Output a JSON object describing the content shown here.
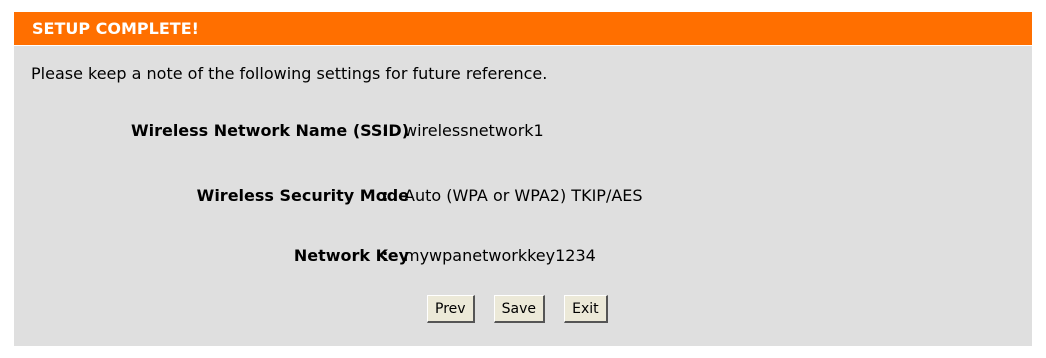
{
  "title": "SETUP COMPLETE!",
  "intro": "Please keep a note of the following settings for future reference.",
  "settings": [
    {
      "label": "Wireless Network Name (SSID)",
      "separator": ":",
      "value": "wirelessnetwork1"
    },
    {
      "label": "Wireless Security Mode",
      "separator": ":",
      "value": "Auto (WPA or WPA2) TKIP/AES"
    },
    {
      "label": "Network Key",
      "separator": ":",
      "value": "mywpanetworkkey1234"
    }
  ],
  "buttons": {
    "prev": "Prev",
    "save": "Save",
    "exit": "Exit"
  },
  "colors": {
    "title_bar": "#ff6f00",
    "panel_bg": "#dfdfdf"
  }
}
